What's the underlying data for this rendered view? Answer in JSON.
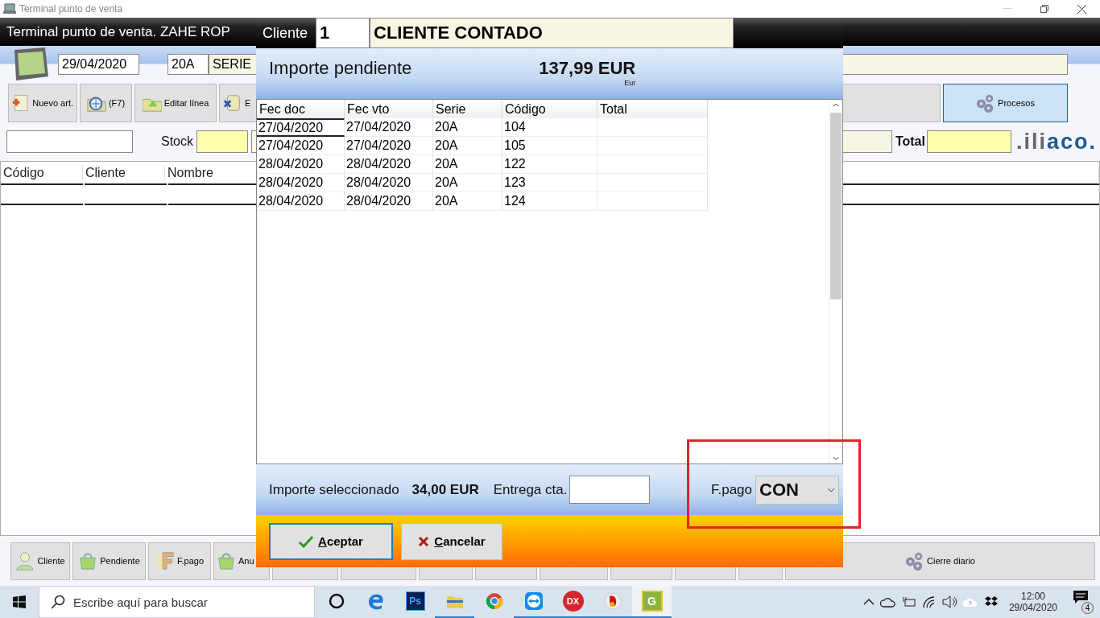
{
  "os_window": {
    "title": "Terminal punto de venta"
  },
  "app_header": {
    "title": "Terminal punto de venta. ZAHE ROP"
  },
  "document": {
    "date": "29/04/2020",
    "series_code": "20A",
    "series_name": "SERIE"
  },
  "toolbar": [
    {
      "label": "Nuevo art.",
      "highlighted": false
    },
    {
      "label": "(F7)",
      "highlighted": false
    },
    {
      "label": "Editar línea",
      "highlighted": false
    },
    {
      "label": "E",
      "highlighted": false
    },
    {
      "label": "Procesos",
      "highlighted": true
    }
  ],
  "filter_row": {
    "stock_label": "Stock",
    "total_label": "Total",
    "logo": {
      "gray_part": ".ili",
      "blue_part": "aco."
    }
  },
  "list_table": {
    "columns": [
      "Código",
      "Cliente",
      "Nombre"
    ]
  },
  "bottom_bar": [
    {
      "kind": "labeled",
      "label": "Cliente"
    },
    {
      "kind": "labeled",
      "label": "Pendiente"
    },
    {
      "kind": "labeled",
      "label": "F.pago"
    },
    {
      "kind": "labeled",
      "label": "Anu"
    },
    {
      "kind": "blank"
    },
    {
      "kind": "blank"
    },
    {
      "kind": "blank"
    },
    {
      "kind": "blank"
    },
    {
      "kind": "blank"
    },
    {
      "kind": "blank"
    },
    {
      "kind": "blank"
    },
    {
      "kind": "blank"
    },
    {
      "kind": "labeled",
      "label": "Cierre diario"
    }
  ],
  "dialog": {
    "client_label": "Cliente",
    "client_code": "1",
    "client_name": "CLIENTE CONTADO",
    "pending_label": "Importe pendiente",
    "pending_amount": "137,99 EUR",
    "pending_unit": "Eur",
    "table": {
      "columns": [
        "Fec doc",
        "Fec vto",
        "Serie",
        "Código",
        "Total"
      ],
      "rows": [
        {
          "fec_doc": "27/04/2020",
          "fec_vto": "27/04/2020",
          "serie": "20A",
          "codigo": "104"
        },
        {
          "fec_doc": "27/04/2020",
          "fec_vto": "27/04/2020",
          "serie": "20A",
          "codigo": "105"
        },
        {
          "fec_doc": "28/04/2020",
          "fec_vto": "28/04/2020",
          "serie": "20A",
          "codigo": "122"
        },
        {
          "fec_doc": "28/04/2020",
          "fec_vto": "28/04/2020",
          "serie": "20A",
          "codigo": "123"
        },
        {
          "fec_doc": "28/04/2020",
          "fec_vto": "28/04/2020",
          "serie": "20A",
          "codigo": "124"
        }
      ]
    },
    "selected_label": "Importe seleccionado",
    "selected_amount": "34,00 EUR",
    "deposit_label": "Entrega cta.",
    "payment_label": "F.pago",
    "payment_value": "CON",
    "buttons": [
      {
        "kind": "accept",
        "label": "Aceptar",
        "focused": true
      },
      {
        "kind": "cancel",
        "label": "Cancelar",
        "focused": false
      }
    ]
  },
  "taskbar": {
    "search_placeholder": "Escribe aquí para buscar",
    "apps": [
      {
        "kind": "cortana",
        "running": false,
        "active": false
      },
      {
        "kind": "edge",
        "running": false,
        "active": false
      },
      {
        "kind": "photoshop",
        "label": "Ps",
        "running": false,
        "active": false
      },
      {
        "kind": "explorer",
        "running": true,
        "active": false
      },
      {
        "kind": "chrome",
        "running": false,
        "active": false
      },
      {
        "kind": "teamviewer",
        "running": true,
        "active": false
      },
      {
        "kind": "dx",
        "label": "DX",
        "running": true,
        "active": false
      },
      {
        "kind": "bird",
        "running": true,
        "active": false
      },
      {
        "kind": "g",
        "label": "G",
        "running": true,
        "active": true
      }
    ],
    "time": "12:00",
    "date": "29/04/2020",
    "notifications": "4"
  }
}
